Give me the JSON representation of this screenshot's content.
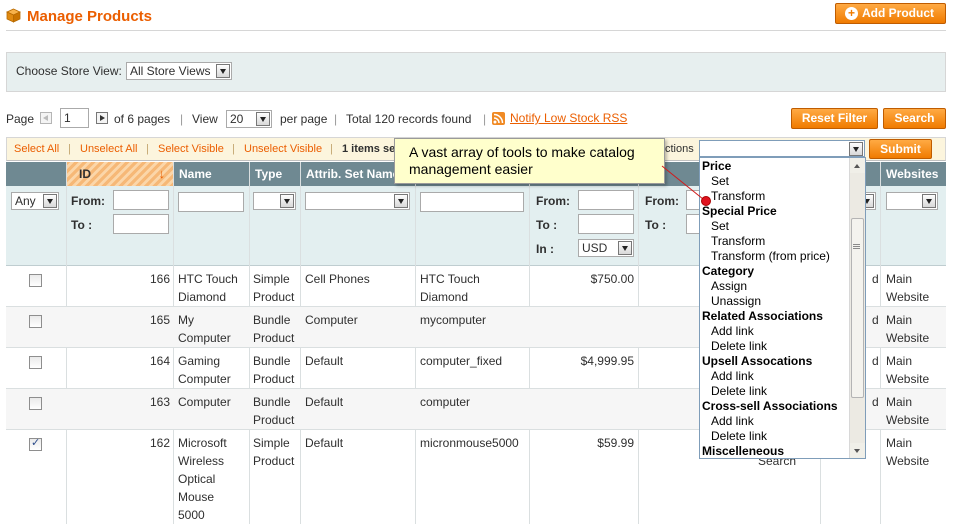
{
  "header": {
    "title": "Manage Products",
    "add_button": "Add Product",
    "title_icon": "box-icon",
    "accent_color": "#eb5e00"
  },
  "store_switcher": {
    "label": "Choose Store View:",
    "value": "All Store Views"
  },
  "pager": {
    "page_label": "Page",
    "page_value": "1",
    "of_pages": "of 6 pages",
    "view_label": "View",
    "view_value": "20",
    "per_page": "per page",
    "total": "Total 120 records found",
    "rss_link": "Notify Low Stock RSS",
    "reset_filter": "Reset Filter",
    "search": "Search"
  },
  "massaction": {
    "select_all": "Select All",
    "unselect_all": "Unselect All",
    "select_visible": "Select Visible",
    "unselect_visible": "Unselect Visible",
    "items_selected": "1 items sel",
    "actions_label": "ctions",
    "submit": "Submit"
  },
  "grid": {
    "columns": {
      "id": "ID",
      "name": "Name",
      "type": "Type",
      "attrib_set": "Attrib. Set Name",
      "websites": "Websites"
    },
    "filters": {
      "any": "Any",
      "from": "From:",
      "to": "To :",
      "in": "In :",
      "currency": "USD"
    },
    "rows": [
      {
        "id": "166",
        "name": "HTC Touch Diamond",
        "type": "Simple Product",
        "attrib": "Cell Phones",
        "sku": "HTC Touch Diamond",
        "price": "$750.00",
        "qty": "d",
        "website": "Main Website",
        "checked": false
      },
      {
        "id": "165",
        "name": "My Computer",
        "type": "Bundle Product",
        "attrib": "Computer",
        "sku": "mycomputer",
        "price": "",
        "qty": "d",
        "website": "Main Website",
        "checked": false
      },
      {
        "id": "164",
        "name": "Gaming Computer",
        "type": "Bundle Product",
        "attrib": "Default",
        "sku": "computer_fixed",
        "price": "$4,999.95",
        "qty": "d",
        "website": "Main Website",
        "checked": false
      },
      {
        "id": "163",
        "name": "Computer",
        "type": "Bundle Product",
        "attrib": "Default",
        "sku": "computer",
        "price": "",
        "qty": "d",
        "website": "Main Website",
        "checked": false
      },
      {
        "id": "162",
        "name": "Microsoft Wireless Optical Mouse 5000",
        "type": "Simple Product",
        "attrib": "Default",
        "sku": "micronmouse5000",
        "price": "$59.99",
        "qty": "Search",
        "website": "Main Website",
        "checked": true
      }
    ]
  },
  "actions_dropdown": {
    "items": [
      {
        "label": "Price",
        "group": true
      },
      {
        "label": "Set",
        "group": false
      },
      {
        "label": "Transform",
        "group": false
      },
      {
        "label": "Special Price",
        "group": true
      },
      {
        "label": "Set",
        "group": false
      },
      {
        "label": "Transform",
        "group": false
      },
      {
        "label": "Transform (from price)",
        "group": false
      },
      {
        "label": "Category",
        "group": true
      },
      {
        "label": "Assign",
        "group": false
      },
      {
        "label": "Unassign",
        "group": false
      },
      {
        "label": "Related Associations",
        "group": true
      },
      {
        "label": "Add link",
        "group": false
      },
      {
        "label": "Delete link",
        "group": false
      },
      {
        "label": "Upsell Assocations",
        "group": true
      },
      {
        "label": "Add link",
        "group": false
      },
      {
        "label": "Delete link",
        "group": false
      },
      {
        "label": "Cross-sell Associations",
        "group": true
      },
      {
        "label": "Add link",
        "group": false
      },
      {
        "label": "Delete link",
        "group": false
      },
      {
        "label": "Miscelleneous",
        "group": true
      }
    ]
  },
  "callout": {
    "text": "A vast array of tools to make catalog management easier"
  }
}
